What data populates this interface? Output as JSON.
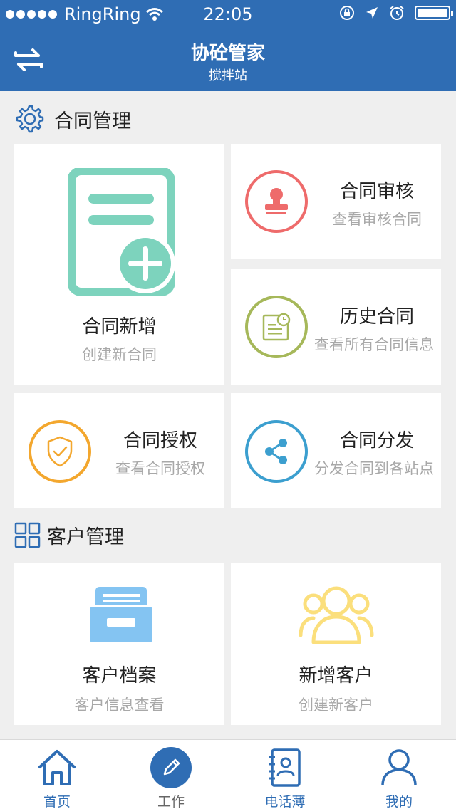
{
  "status_bar": {
    "carrier": "RingRing",
    "time": "22:05"
  },
  "nav": {
    "title": "协砼管家",
    "subtitle": "搅拌站",
    "back_icon": "swap-arrows-icon"
  },
  "sections": {
    "contract": {
      "label": "合同管理",
      "icon": "gear-icon"
    },
    "customer": {
      "label": "客户管理",
      "icon": "grid-icon"
    }
  },
  "tiles": {
    "contract_new": {
      "title": "合同新增",
      "sub": "创建新合同",
      "color": "#7dd3bd"
    },
    "contract_review": {
      "title": "合同审核",
      "sub": "查看审核合同",
      "color": "#ee6b6b"
    },
    "contract_history": {
      "title": "历史合同",
      "sub": "查看所有合同信息",
      "color": "#a6b85a"
    },
    "contract_auth": {
      "title": "合同授权",
      "sub": "查看合同授权",
      "color": "#f3a72e"
    },
    "contract_distribute": {
      "title": "合同分发",
      "sub": "分发合同到各站点",
      "color": "#3c9fcf"
    },
    "customer_archive": {
      "title": "客户档案",
      "sub": "客户信息查看",
      "color": "#84c4f2"
    },
    "customer_new": {
      "title": "新增客户",
      "sub": "创建新客户",
      "color": "#fbdf7c"
    }
  },
  "tabbar": [
    {
      "label": "首页",
      "icon": "home-icon"
    },
    {
      "label": "工作",
      "icon": "pencil-icon",
      "active": true
    },
    {
      "label": "电话薄",
      "icon": "contacts-book-icon"
    },
    {
      "label": "我的",
      "icon": "person-icon"
    }
  ],
  "colors": {
    "brand": "#2f6db4",
    "background": "#efefef"
  }
}
